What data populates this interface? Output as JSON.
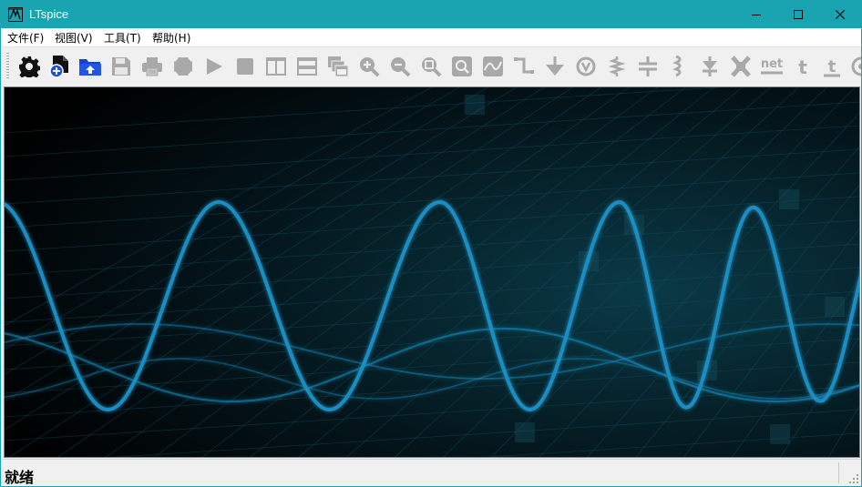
{
  "window": {
    "title": "LTspice",
    "title_bar_color": "#1aa3b0",
    "controls": [
      "minimize-icon",
      "maximize-icon",
      "close-icon"
    ]
  },
  "menu": {
    "items": [
      {
        "label": "文件(F)"
      },
      {
        "label": "视图(V)"
      },
      {
        "label": "工具(T)"
      },
      {
        "label": "帮助(H)"
      }
    ]
  },
  "toolbar": {
    "buttons": [
      {
        "icon": "settings-gear-icon",
        "enabled": true
      },
      {
        "icon": "new-schematic-icon",
        "enabled": true
      },
      {
        "icon": "open-folder-icon",
        "enabled": true
      },
      {
        "icon": "save-icon",
        "enabled": false
      },
      {
        "icon": "print-icon",
        "enabled": false
      },
      {
        "icon": "component-chip-icon",
        "enabled": false
      },
      {
        "icon": "run-icon",
        "enabled": false
      },
      {
        "icon": "halt-icon",
        "enabled": false
      },
      {
        "icon": "tile-vertical-icon",
        "enabled": false
      },
      {
        "icon": "tile-horizontal-icon",
        "enabled": false
      },
      {
        "icon": "cascade-windows-icon",
        "enabled": false
      },
      {
        "icon": "zoom-in-icon",
        "enabled": false
      },
      {
        "icon": "zoom-out-icon",
        "enabled": false
      },
      {
        "icon": "zoom-fit-icon",
        "enabled": false
      },
      {
        "icon": "zoom-full-icon",
        "enabled": false
      },
      {
        "icon": "autorange-icon",
        "enabled": false
      },
      {
        "icon": "draw-wire-icon",
        "enabled": false
      },
      {
        "icon": "ground-icon",
        "enabled": false
      },
      {
        "icon": "voltage-source-icon",
        "enabled": false
      },
      {
        "icon": "resistor-icon",
        "enabled": false
      },
      {
        "icon": "capacitor-icon",
        "enabled": false
      },
      {
        "icon": "inductor-icon",
        "enabled": false
      },
      {
        "icon": "diode-icon",
        "enabled": false
      },
      {
        "icon": "component-icon",
        "enabled": false
      },
      {
        "icon": "net-label-icon",
        "label": "net",
        "enabled": false
      },
      {
        "icon": "text-icon",
        "label": "t",
        "enabled": false
      },
      {
        "icon": "spice-directive-icon",
        "label": "t",
        "enabled": false
      },
      {
        "icon": "more-icon",
        "enabled": false
      }
    ]
  },
  "canvas": {
    "background_color": "#000000",
    "wave_color": "#1a8fc4",
    "grid_color": "#0f4a5c"
  },
  "status": {
    "text": "就绪"
  }
}
